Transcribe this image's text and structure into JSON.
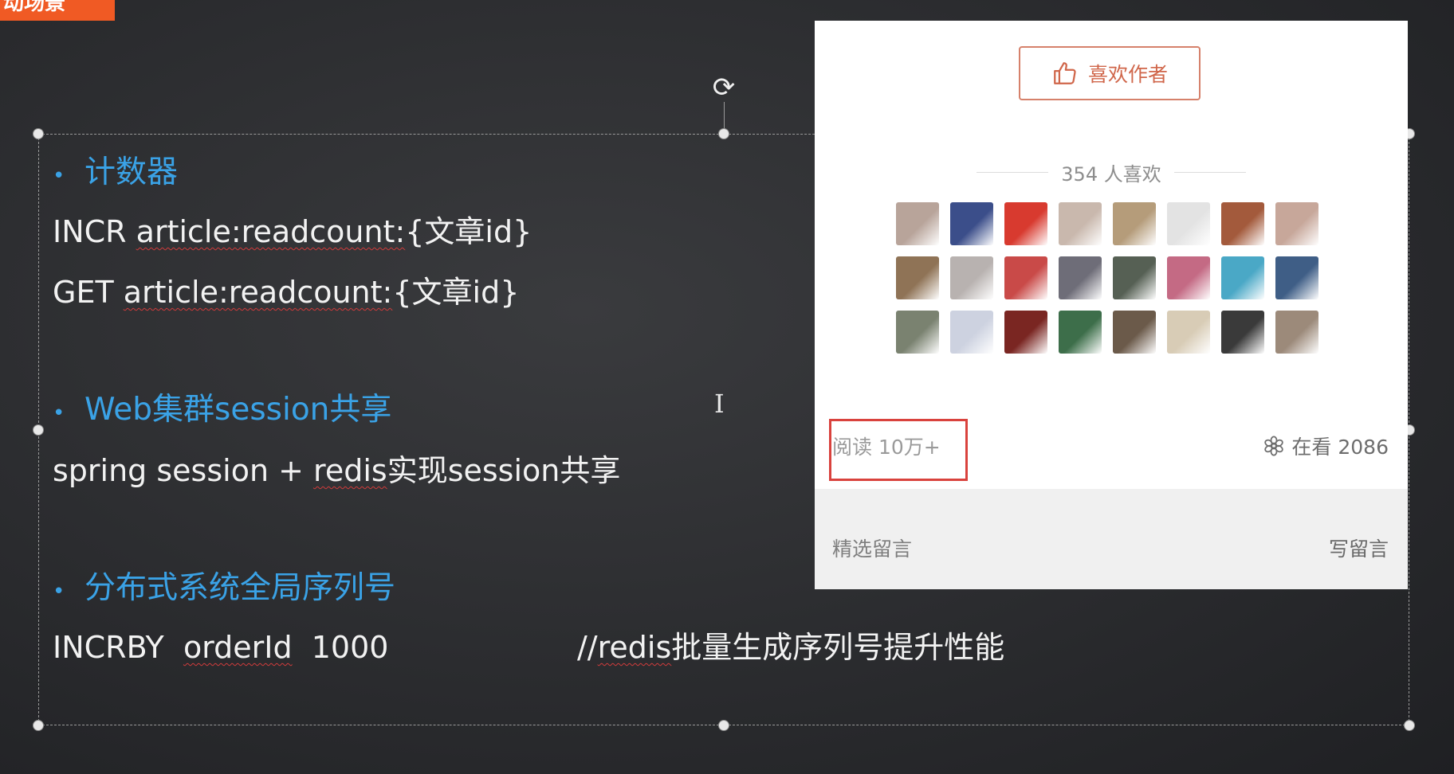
{
  "corner_label": "动场景",
  "slide": {
    "sections": [
      {
        "heading": "计数器",
        "lines": [
          {
            "prefix": "INCR ",
            "underlined": "article:readcount:",
            "suffix": "{文章id}"
          },
          {
            "prefix": "GET ",
            "underlined": "article:readcount:",
            "suffix": "{文章id}"
          }
        ]
      },
      {
        "heading": "Web集群session共享",
        "lines": [
          {
            "prefix": "spring session + ",
            "underlined": "redis",
            "suffix": "实现session共享"
          }
        ]
      },
      {
        "heading": "分布式系统全局序列号",
        "lines": [
          {
            "prefix": "INCRBY  ",
            "underlined": "orderId",
            "suffix": "  1000"
          }
        ]
      }
    ],
    "comment": {
      "prefix": "//",
      "underlined": "redis",
      "suffix": "批量生成序列号提升性能"
    }
  },
  "article_panel": {
    "like_button_label": "喜欢作者",
    "likes_text": "354 人喜欢",
    "read_count": "阅读 10万+",
    "watching": "在看 2086",
    "featured_comments": "精选留言",
    "write_comment": "写留言",
    "avatar_colors": [
      "#b8a49a",
      "#3b4e8a",
      "#d83a2f",
      "#c9b8ad",
      "#b59c7a",
      "#e3e3e3",
      "#a35a3c",
      "#c7a79a",
      "#8f7356",
      "#b8b2b0",
      "#c94a48",
      "#6e6d78",
      "#566054",
      "#c46a84",
      "#4aa8c6",
      "#3f5e86",
      "#7a8270",
      "#cdd2e0",
      "#7a2622",
      "#3d6e4a",
      "#6b5a4a",
      "#d8ccb6",
      "#3a3a3a",
      "#9c8a7a"
    ],
    "highlight_color": "#d9423d",
    "accent_color": "#d0664a"
  },
  "heading_color": "#3aa2e6",
  "corner_color": "#f05a24"
}
